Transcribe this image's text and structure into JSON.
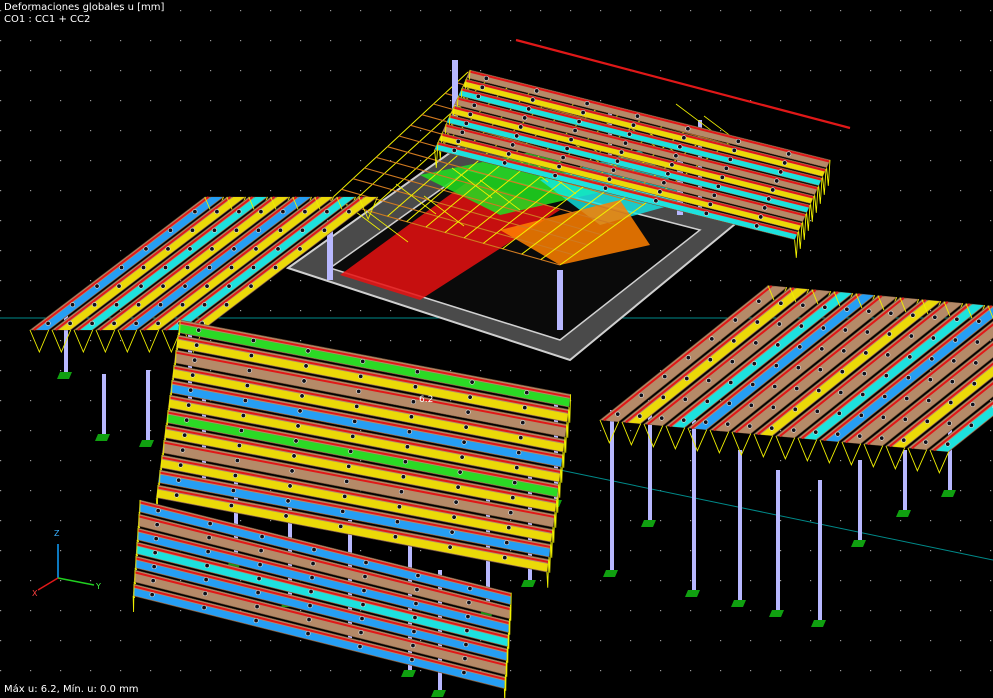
{
  "result_panel": {
    "title": "Deformaciones globales u [mm]",
    "load_combination": "CO1 : CC1 + CC2",
    "extremes": "Máx u: 6.2, Mín. u: 0.0 mm",
    "max_value_label": "6.2"
  },
  "axes": {
    "z": "Z",
    "x": "X",
    "y": "Y"
  },
  "colors": {
    "background": "#000000",
    "grid_dots": "#9a9a9a",
    "membrane_base": "#b58a68",
    "ridge": "#e01818",
    "cable": "#f0f000",
    "column": "#b8b8ff",
    "support": "#10a010",
    "guide_line": "#008a8a",
    "deform_blue": "#1aa0ff",
    "deform_cyan": "#10e8e8",
    "deform_green": "#20e020",
    "deform_yellow": "#f0e000",
    "deform_orange": "#ff8000",
    "deform_red": "#e81010"
  }
}
